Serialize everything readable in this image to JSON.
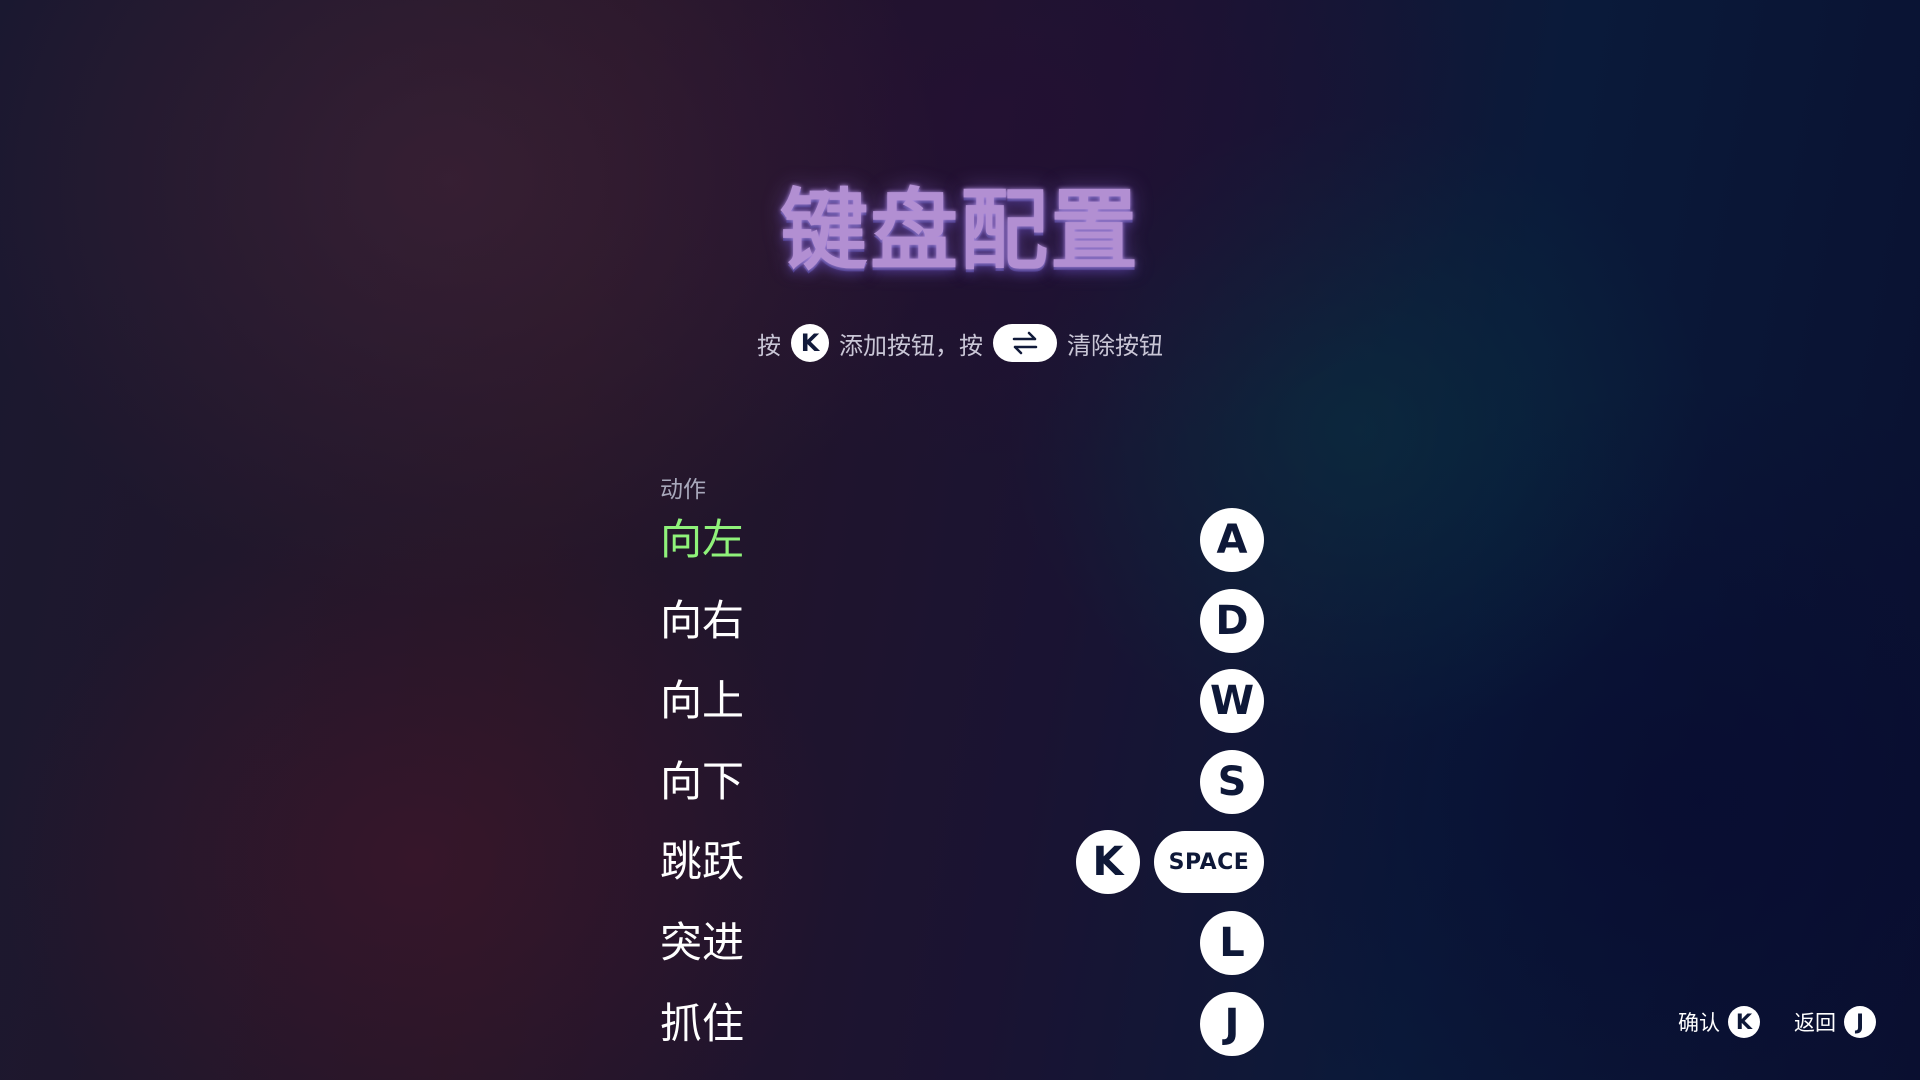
{
  "title": "键盘配置",
  "hint": {
    "part1": "按",
    "add_key": "K",
    "part2": "添加按钮，按",
    "clear_icon": "swap-arrows-icon",
    "part3": "清除按钮"
  },
  "section_label": "动作",
  "actions": [
    {
      "label": "向左",
      "keys": [
        "A"
      ],
      "selected": true
    },
    {
      "label": "向右",
      "keys": [
        "D"
      ],
      "selected": false
    },
    {
      "label": "向上",
      "keys": [
        "W"
      ],
      "selected": false
    },
    {
      "label": "向下",
      "keys": [
        "S"
      ],
      "selected": false
    },
    {
      "label": "跳跃",
      "keys": [
        "K",
        "SPACE"
      ],
      "selected": false
    },
    {
      "label": "突进",
      "keys": [
        "L"
      ],
      "selected": false
    },
    {
      "label": "抓住",
      "keys": [
        "J"
      ],
      "selected": false
    }
  ],
  "footer": {
    "confirm_label": "确认",
    "confirm_key": "K",
    "back_label": "返回",
    "back_key": "J"
  },
  "colors": {
    "title": "#b28fd2",
    "selected_action": "#8ff27a",
    "key_bg": "#ffffff",
    "key_text": "#0e1838"
  }
}
